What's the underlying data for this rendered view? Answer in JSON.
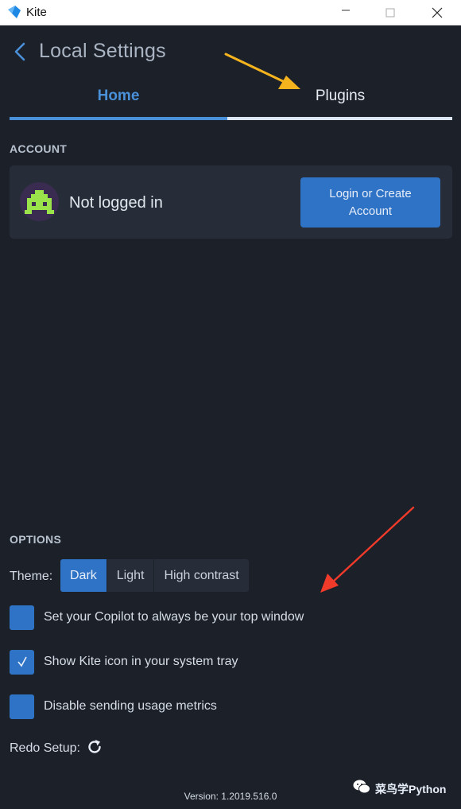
{
  "window": {
    "title": "Kite"
  },
  "header": {
    "title": "Local Settings"
  },
  "tabs": [
    {
      "label": "Home",
      "active": true
    },
    {
      "label": "Plugins",
      "active": false
    }
  ],
  "account": {
    "section_label": "ACCOUNT",
    "status": "Not logged in",
    "login_button": "Login or Create Account"
  },
  "options": {
    "section_label": "OPTIONS",
    "theme_label": "Theme:",
    "themes": [
      {
        "label": "Dark",
        "selected": true
      },
      {
        "label": "Light",
        "selected": false
      },
      {
        "label": "High contrast",
        "selected": false
      }
    ],
    "checkboxes": [
      {
        "label": "Set your Copilot to always be your top window",
        "checked": false
      },
      {
        "label": "Show Kite icon in your system tray",
        "checked": true
      },
      {
        "label": "Disable sending usage metrics",
        "checked": false
      }
    ],
    "redo_label": "Redo Setup:"
  },
  "version": "Version: 1.2019.516.0",
  "watermark": "菜鸟学Python",
  "colors": {
    "accent": "#2f73c6",
    "tab_active": "#4a90d9",
    "background": "#1b2029",
    "card": "#262d38",
    "arrow_yellow": "#f5b41e",
    "arrow_red": "#f03a2a"
  },
  "icons": {
    "app": "kite-logo-icon",
    "back": "chevron-left-icon",
    "avatar": "space-invader-icon",
    "redo": "refresh-icon",
    "watermark": "wechat-icon"
  }
}
